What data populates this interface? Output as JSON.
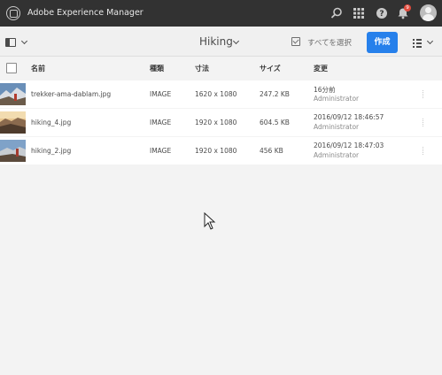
{
  "shell": {
    "title": "Adobe Experience Manager",
    "icons": [
      "search-icon",
      "apps-grid-icon",
      "help-icon",
      "bell-icon",
      "user-avatar"
    ],
    "notifications_count": "9"
  },
  "actionbar": {
    "title": "Hiking",
    "select_all": "すべてを選択",
    "create": "作成"
  },
  "table": {
    "columns": [
      "名前",
      "種類",
      "寸法",
      "サイズ",
      "変更"
    ],
    "rows": [
      {
        "name": "trekker-ama-dablam.jpg",
        "type": "IMAGE",
        "dimensions": "1620 x 1080",
        "size": "247.2 KB",
        "modified": "16分前",
        "modified_by": "Administrator"
      },
      {
        "name": "hiking_4.jpg",
        "type": "IMAGE",
        "dimensions": "1920 x 1080",
        "size": "604.5 KB",
        "modified": "2016/09/12 18:46:57",
        "modified_by": "Administrator"
      },
      {
        "name": "hiking_2.jpg",
        "type": "IMAGE",
        "dimensions": "1920 x 1080",
        "size": "456 KB",
        "modified": "2016/09/12 18:47:03",
        "modified_by": "Administrator"
      }
    ]
  },
  "colors": {
    "shell": "#323232",
    "accent": "#2680eb",
    "badge": "#e14a3c"
  }
}
